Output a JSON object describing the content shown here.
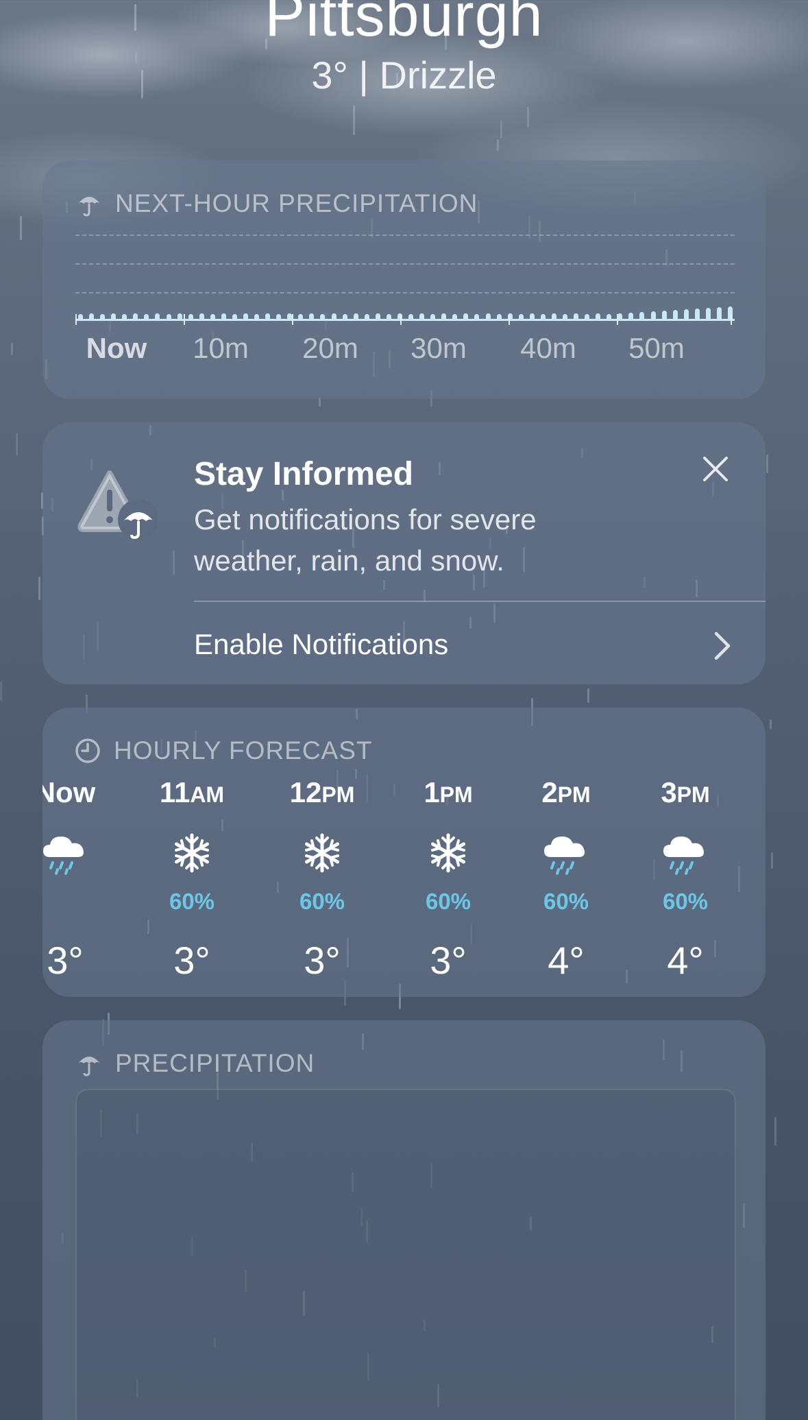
{
  "header": {
    "city": "Pittsburgh",
    "condition": "3°  |  Drizzle"
  },
  "next_hour": {
    "title": "NEXT-HOUR PRECIPITATION",
    "time_labels": [
      "Now",
      "10m",
      "20m",
      "30m",
      "40m",
      "50m"
    ]
  },
  "stay_informed": {
    "title": "Stay Informed",
    "description": "Get notifications for severe weather, rain, and snow.",
    "enable_label": "Enable Notifications"
  },
  "hourly": {
    "title": "HOURLY FORECAST",
    "hours": [
      {
        "time": "Now",
        "suffix": "",
        "icon": "rain-cloud-icon",
        "pop": "",
        "temp": "3°"
      },
      {
        "time": "11",
        "suffix": "AM",
        "icon": "snowflake-icon",
        "pop": "60%",
        "temp": "3°"
      },
      {
        "time": "12",
        "suffix": "PM",
        "icon": "snowflake-icon",
        "pop": "60%",
        "temp": "3°"
      },
      {
        "time": "1",
        "suffix": "PM",
        "icon": "snowflake-icon",
        "pop": "60%",
        "temp": "3°"
      },
      {
        "time": "2",
        "suffix": "PM",
        "icon": "rain-cloud-icon",
        "pop": "60%",
        "temp": "4°"
      },
      {
        "time": "3",
        "suffix": "PM",
        "icon": "rain-cloud-icon",
        "pop": "60%",
        "temp": "4°"
      }
    ]
  },
  "precipitation": {
    "title": "PRECIPITATION"
  },
  "colors": {
    "accent_pop": "#6cc7e6",
    "precip_bar": "#c6e9f6"
  }
}
